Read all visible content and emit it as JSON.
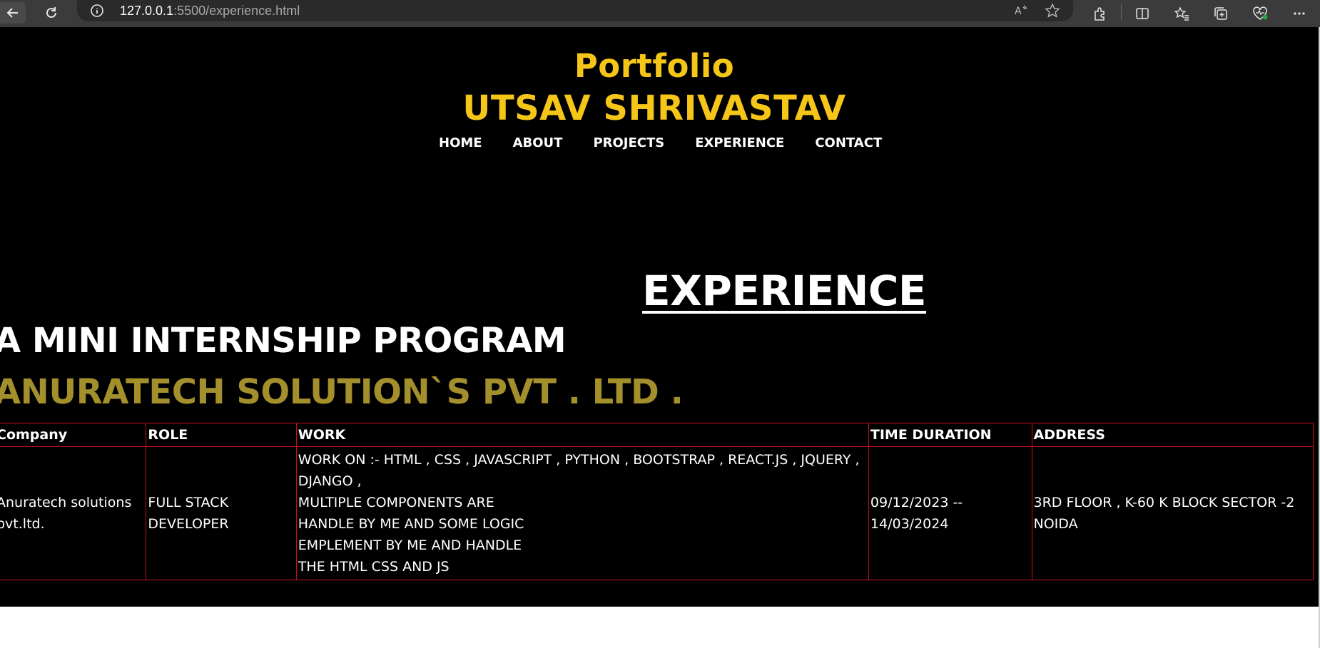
{
  "browser": {
    "url_host": "127.0.0.1",
    "url_rest": ":5500/experience.html"
  },
  "header": {
    "title": "Portfolio",
    "name": "UTSAV SHRIVASTAV"
  },
  "nav": [
    "HOME",
    "ABOUT",
    "PROJECTS",
    "EXPERIENCE",
    "CONTACT"
  ],
  "main": {
    "heading": "EXPERIENCE",
    "program": "A MINI INTERNSHIP PROGRAM",
    "company": "ANURATECH SOLUTION`S PVT . LTD ."
  },
  "table": {
    "headers": [
      "Company",
      "ROLE",
      "WORK",
      "TIME DURATION",
      "ADDRESS"
    ],
    "row": {
      "company": [
        "Anuratech solutions",
        "pvt.ltd."
      ],
      "role": [
        "FULL STACK",
        "DEVELOPER"
      ],
      "work": [
        "WORK ON :- HTML , CSS , JAVASCRIPT , PYTHON , BOOTSTRAP , REACT.JS , JQUERY ,",
        "DJANGO ,",
        "MULTIPLE COMPONENTS ARE",
        "HANDLE BY ME AND SOME LOGIC",
        "EMPLEMENT BY ME AND HANDLE",
        "THE HTML CSS AND JS"
      ],
      "duration": [
        "09/12/2023 --",
        "14/03/2024"
      ],
      "address": [
        "3RD FLOOR , K-60 K BLOCK SECTOR -2",
        "NOIDA"
      ]
    }
  },
  "colors": {
    "accent": "#f5c518",
    "company": "#a38f2b",
    "table_border": "#c8101a",
    "page_bg": "#000000"
  },
  "icons": [
    "back-arrow-icon",
    "reload-icon",
    "info-icon",
    "read-aloud-icon",
    "favorite-star-icon",
    "extensions-icon",
    "split-screen-icon",
    "favorites-icon",
    "collections-icon",
    "browser-essentials-icon",
    "more-icon"
  ]
}
